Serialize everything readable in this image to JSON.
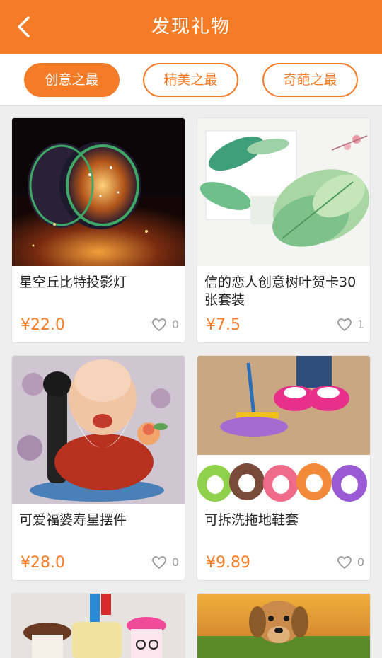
{
  "header": {
    "title": "发现礼物",
    "back_icon": "back-arrow-icon"
  },
  "tabs": [
    {
      "label": "创意之最",
      "active": true
    },
    {
      "label": "精美之最",
      "active": false
    },
    {
      "label": "奇葩之最",
      "active": false
    }
  ],
  "products": [
    {
      "title": "星空丘比特投影灯",
      "price": "¥22.0",
      "likes": "0"
    },
    {
      "title": "信的恋人创意树叶贺卡30张套装",
      "price": "¥7.5",
      "likes": "1"
    },
    {
      "title": "可爱福婆寿星摆件",
      "price": "¥28.0",
      "likes": "0"
    },
    {
      "title": "可拆洗拖地鞋套",
      "price": "¥9.89",
      "likes": "0"
    }
  ],
  "colors": {
    "accent": "#f57c27",
    "background": "#eeeeee"
  }
}
